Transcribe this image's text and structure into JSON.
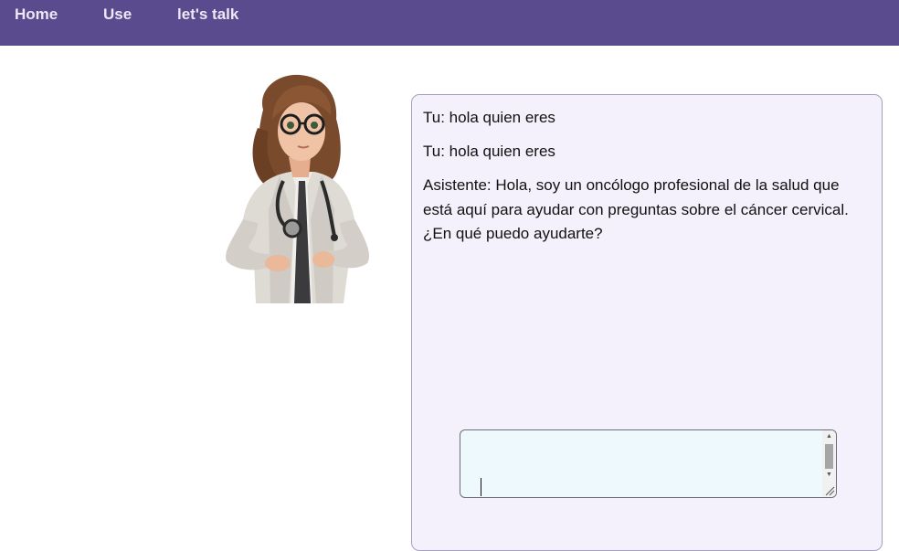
{
  "nav": {
    "home": "Home",
    "use": "Use",
    "talk": "let's talk"
  },
  "avatar": {
    "description_icon": "doctor-avatar-icon"
  },
  "chat": {
    "messages": [
      "Tu: hola quien eres",
      "Tu: hola quien eres",
      "Asistente: Hola, soy un oncólogo profesional de la salud que está aquí para ayudar con preguntas sobre el cáncer cervical. ¿En qué puedo ayudarte?"
    ],
    "input_value": ""
  },
  "colors": {
    "navbar": "#5a4a8e",
    "nav_text": "#ece8f6",
    "chat_bg": "#f4f1fc",
    "chat_border": "#a79fc0",
    "input_bg": "#eef9fd"
  }
}
